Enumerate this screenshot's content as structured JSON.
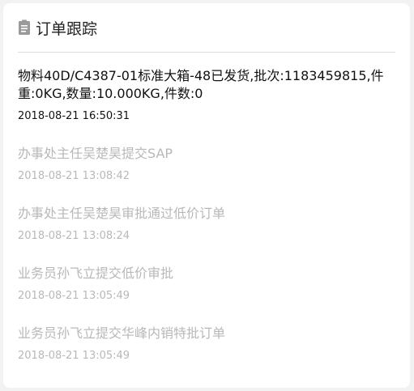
{
  "header": {
    "title": "订单跟踪",
    "icon": "clipboard-icon"
  },
  "events": [
    {
      "text": "物料40D/C4387-01标准大箱-48已发货,批次:1183459815,件重:0KG,数量:10.000KG,件数:0",
      "time": "2018-08-21 16:50:31",
      "active": true
    },
    {
      "text": "办事处主任吴楚昊提交SAP",
      "time": "2018-08-21 13:08:42",
      "active": false
    },
    {
      "text": "办事处主任吴楚昊审批通过低价订单",
      "time": "2018-08-21 13:08:24",
      "active": false
    },
    {
      "text": "业务员孙飞立提交低价审批",
      "time": "2018-08-21 13:05:49",
      "active": false
    },
    {
      "text": "业务员孙飞立提交华峰内销特批订单",
      "time": "2018-08-21 13:05:49",
      "active": false
    }
  ],
  "colors": {
    "active_text": "#111111",
    "inactive_text": "#b8b8b8",
    "divider": "#dedede"
  }
}
